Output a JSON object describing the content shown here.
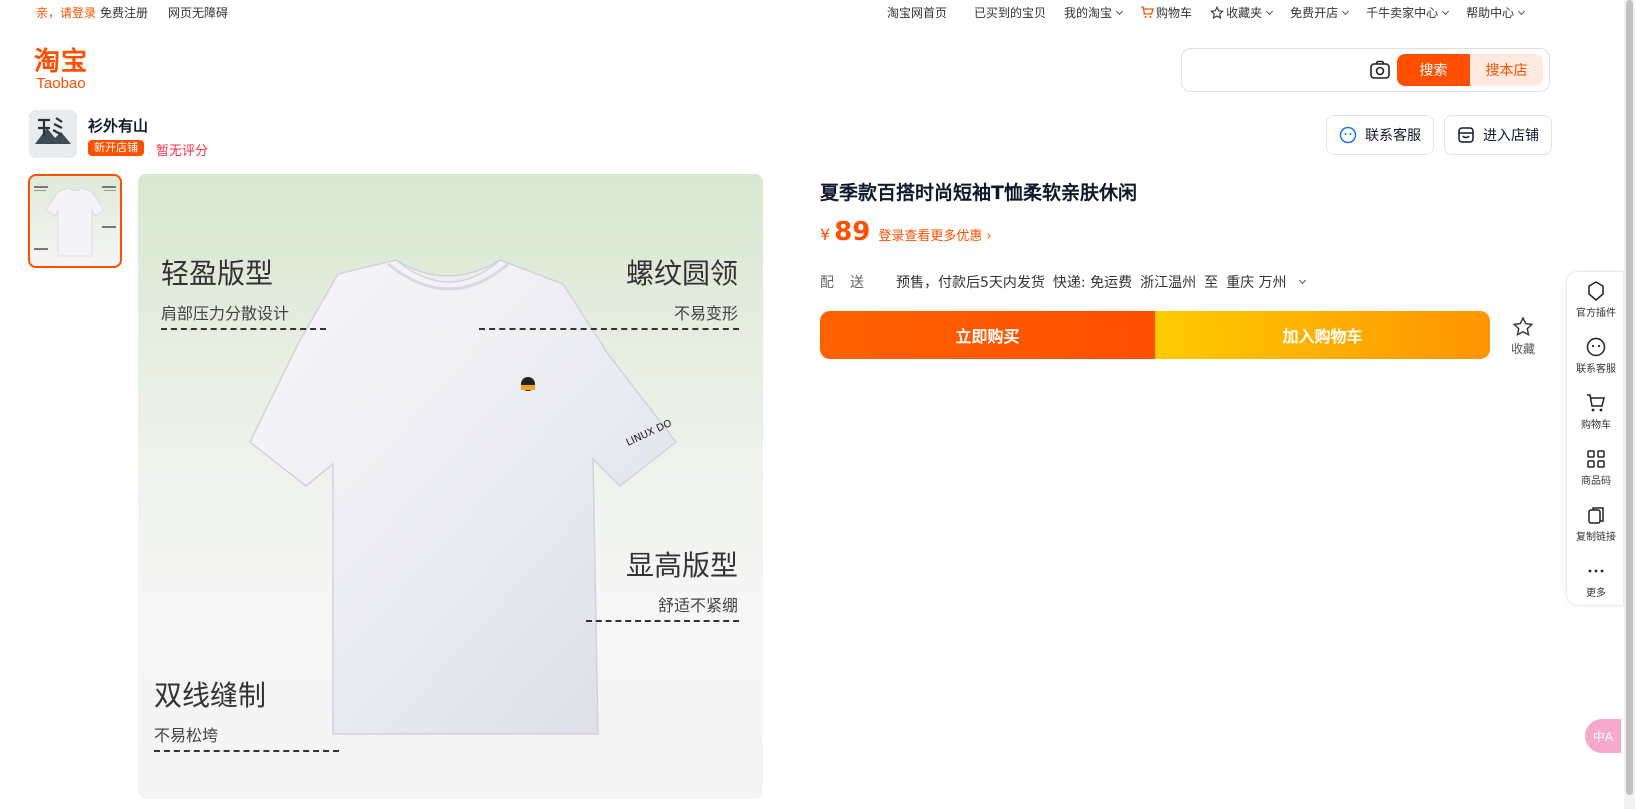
{
  "topbar": {
    "greeting": "亲，请登录",
    "register": "免费注册",
    "accessibility": "网页无障碍",
    "home": "淘宝网首页",
    "purchased": "已买到的宝贝",
    "my_taobao": "我的淘宝",
    "cart": "购物车",
    "favorites": "收藏夹",
    "open_shop": "免费开店",
    "seller_center": "千牛卖家中心",
    "help": "帮助中心"
  },
  "logo": {
    "cn": "淘宝",
    "en": "Taobao"
  },
  "search": {
    "value": "",
    "search_label": "搜索",
    "shop_label": "搜本店"
  },
  "shop": {
    "name": "衫外有山",
    "badge": "新开店铺",
    "rating": "暂无评分",
    "contact": "联系客服",
    "enter": "进入店铺",
    "avatar_text": "衫外有山"
  },
  "image": {
    "f1_title": "轻盈版型",
    "f1_sub": "肩部压力分散设计",
    "f2_title": "螺纹圆领",
    "f2_sub": "不易变形",
    "f3_title": "显高版型",
    "f3_sub": "舒适不紧绷",
    "f4_title": "双线缝制",
    "f4_sub": "不易松垮",
    "sleeve_print": "LINUX DO"
  },
  "product": {
    "title": "夏季款百搭时尚短袖T恤柔软亲肤休闲",
    "price_symbol": "¥",
    "price": "89",
    "login_more": "登录查看更多优惠 ›",
    "ship_label": "配送",
    "ship_presale": "预售，付款后5天内发货",
    "ship_express": "快递: 免运费",
    "ship_from": "浙江温州",
    "ship_to_word": "至",
    "ship_to": "重庆 万州",
    "buy_now": "立即购买",
    "add_cart": "加入购物车",
    "favorite": "收藏"
  },
  "right_toolbar": [
    {
      "label": "官方插件",
      "icon": "plugin-icon"
    },
    {
      "label": "联系客服",
      "icon": "service-icon"
    },
    {
      "label": "购物车",
      "icon": "cart-icon"
    },
    {
      "label": "商品码",
      "icon": "qrcode-icon"
    },
    {
      "label": "复制链接",
      "icon": "copy-icon"
    },
    {
      "label": "更多",
      "icon": "more-icon"
    }
  ],
  "translate_label": "中A",
  "colors": {
    "brand": "#ff5000",
    "cart_gradient_start": "#ffcb00",
    "rating": "#ff2e4d"
  }
}
